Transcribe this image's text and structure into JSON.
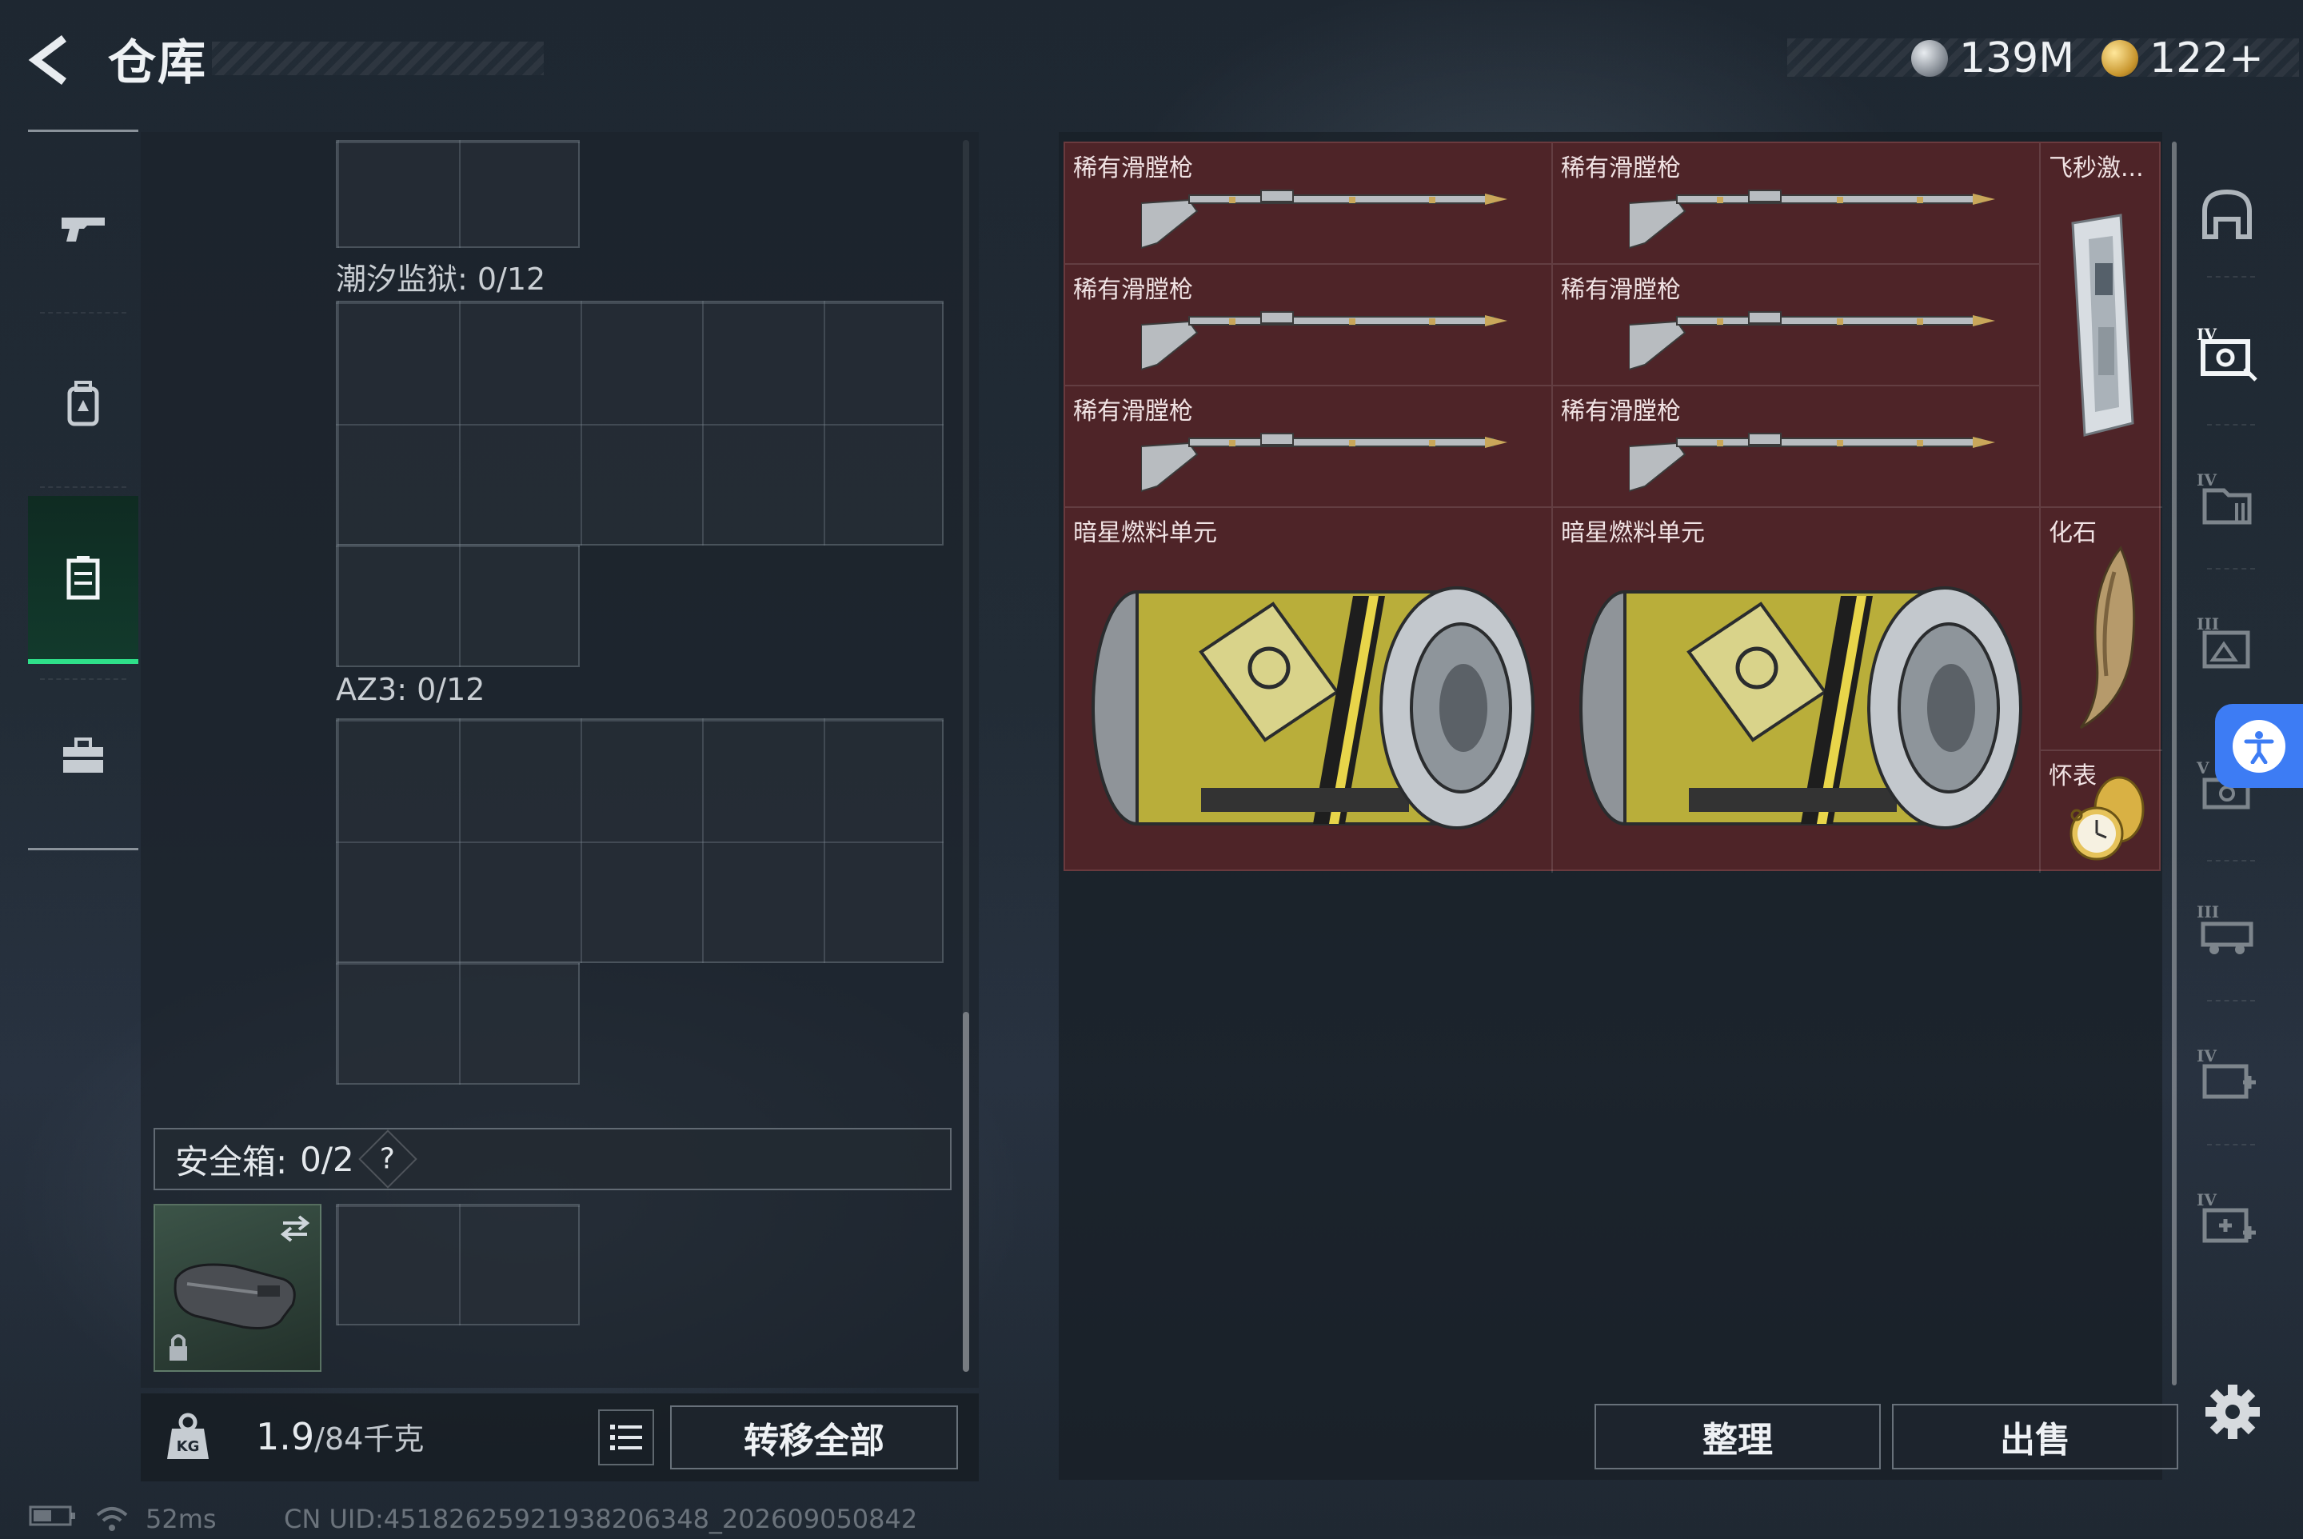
{
  "header": {
    "title": "仓库",
    "currency1": "139M",
    "currency2": "122+"
  },
  "left_nav": {
    "items": [
      {
        "icon": "pistol-icon"
      },
      {
        "icon": "backpack-icon"
      },
      {
        "icon": "storage-case-icon",
        "active": true
      },
      {
        "icon": "toolbox-icon"
      }
    ]
  },
  "containers": {
    "tide_prison_label": "潮汐监狱: 0/12",
    "az3_label": "AZ3: 0/12",
    "safebox_label": "安全箱:",
    "safebox_count": "0/2",
    "safebox_help": "?"
  },
  "footer_left": {
    "weight_value": "1.9",
    "weight_capacity": "/84千克",
    "transfer_all": "转移全部"
  },
  "stash": {
    "items": [
      {
        "name": "稀有滑膛枪"
      },
      {
        "name": "稀有滑膛枪"
      },
      {
        "name": "稀有滑膛枪"
      },
      {
        "name": "稀有滑膛枪"
      },
      {
        "name": "稀有滑膛枪"
      },
      {
        "name": "稀有滑膛枪"
      },
      {
        "name": "飞秒激..."
      },
      {
        "name": "暗星燃料单元"
      },
      {
        "name": "暗星燃料单元"
      },
      {
        "name": "化石"
      },
      {
        "name": "怀表"
      }
    ],
    "sort_label": "整理",
    "sell_label": "出售"
  },
  "category_tabs": [
    {
      "icon": "helmet-icon"
    },
    {
      "icon": "tier4-safe-icon",
      "tier": "IV"
    },
    {
      "icon": "tier4-folder-icon",
      "tier": "IV"
    },
    {
      "icon": "tier3-chart-icon",
      "tier": "III"
    },
    {
      "icon": "tier5-case-icon",
      "tier": "V"
    },
    {
      "icon": "tier3-vehicle-icon",
      "tier": "III"
    },
    {
      "icon": "tier4-medkit-icon",
      "tier": "IV"
    },
    {
      "icon": "tier4-medkit-plus-icon",
      "tier": "IV"
    }
  ],
  "status_bar": {
    "ping": "52ms",
    "uid": "CN UID:4518262592193820634​8_202609050842"
  },
  "colors": {
    "accent_green": "#2fe08a",
    "stash_red": "#4e2428",
    "access_blue": "#3d7cf4"
  }
}
